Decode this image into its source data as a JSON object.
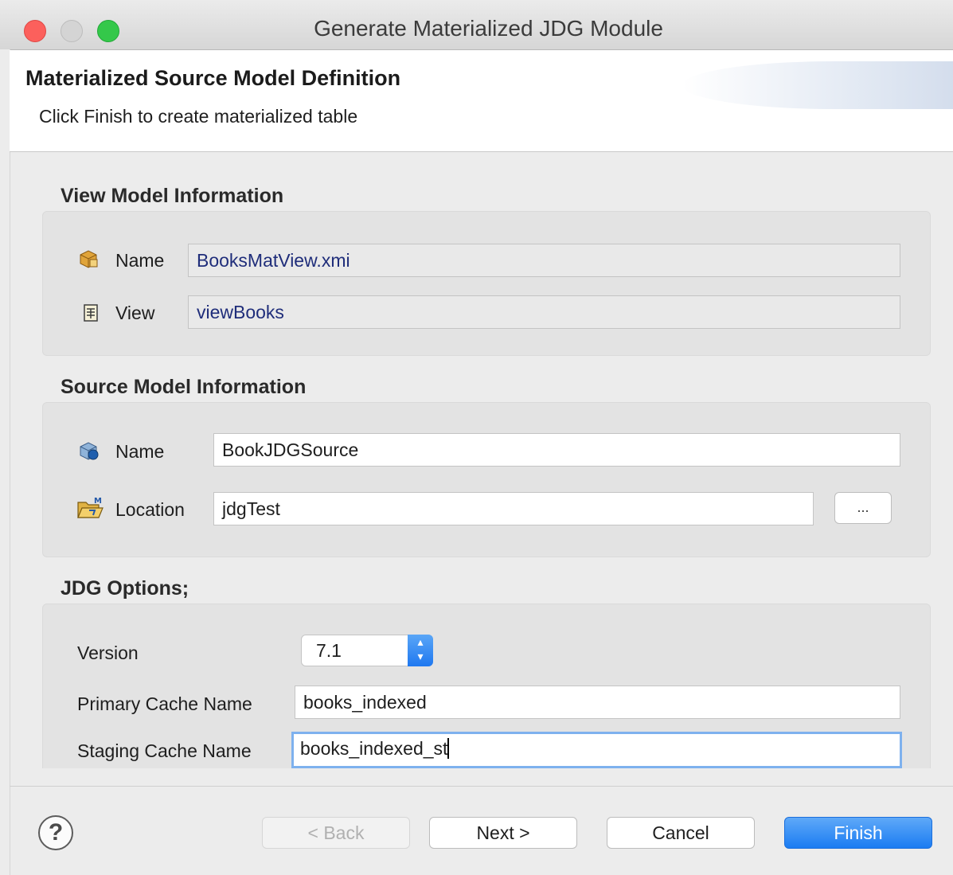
{
  "window": {
    "title": "Generate Materialized JDG Module"
  },
  "banner": {
    "title": "Materialized Source Model Definition",
    "message": "Click Finish to create materialized table"
  },
  "view_model": {
    "heading": "View Model Information",
    "name_label": "Name",
    "name_value": "BooksMatView.xmi",
    "view_label": "View",
    "view_value": "viewBooks"
  },
  "source_model": {
    "heading": "Source Model Information",
    "name_label": "Name",
    "name_value": "BookJDGSource",
    "location_label": "Location",
    "location_value": "jdgTest",
    "browse_label": "..."
  },
  "jdg_options": {
    "heading": "JDG Options;",
    "version_label": "Version",
    "version_value": "7.1",
    "primary_label": "Primary Cache Name",
    "primary_value": "books_indexed",
    "staging_label": "Staging Cache Name",
    "staging_value": "books_indexed_st"
  },
  "buttons": {
    "help": "?",
    "back": "< Back",
    "next": "Next >",
    "cancel": "Cancel",
    "finish": "Finish"
  },
  "colors": {
    "accent": "#1b7cf2",
    "close": "#fc605c",
    "maximize": "#34c84a"
  },
  "icons": {
    "model_name": "model-package-icon",
    "view": "view-table-icon",
    "source_name": "source-model-icon",
    "location": "folder-model-icon"
  }
}
